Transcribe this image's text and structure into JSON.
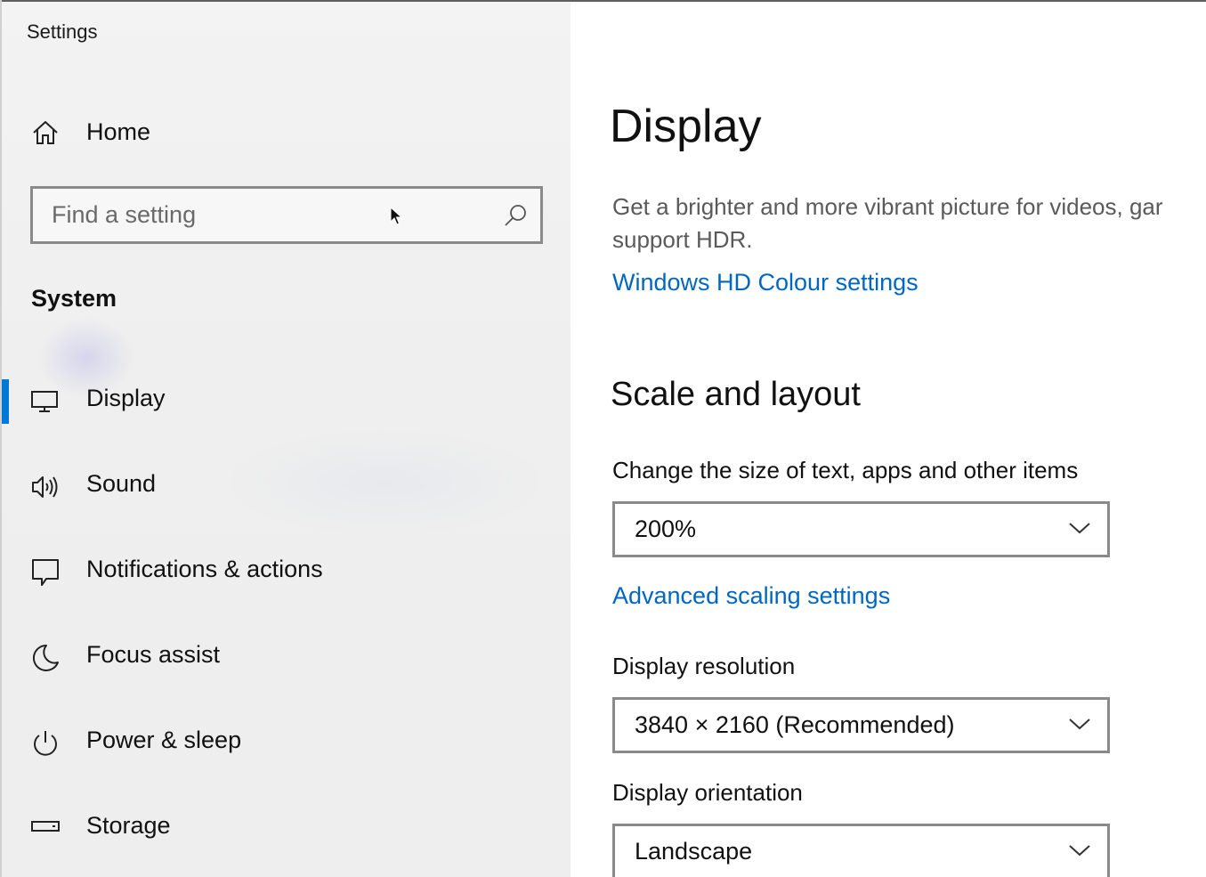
{
  "window": {
    "title": "Settings"
  },
  "sidebar": {
    "home_label": "Home",
    "search": {
      "placeholder": "Find a setting"
    },
    "section_label": "System",
    "items": [
      {
        "label": "Display",
        "icon": "monitor-icon",
        "active": true
      },
      {
        "label": "Sound",
        "icon": "speaker-icon",
        "active": false
      },
      {
        "label": "Notifications & actions",
        "icon": "notification-icon",
        "active": false
      },
      {
        "label": "Focus assist",
        "icon": "moon-icon",
        "active": false
      },
      {
        "label": "Power & sleep",
        "icon": "power-icon",
        "active": false
      },
      {
        "label": "Storage",
        "icon": "storage-icon",
        "active": false
      }
    ]
  },
  "main": {
    "title": "Display",
    "hdr": {
      "description_line1": "Get a brighter and more vibrant picture for videos, gar",
      "description_line2": "support HDR.",
      "link_label": "Windows HD Colour settings"
    },
    "scale_layout": {
      "heading": "Scale and layout",
      "size_label": "Change the size of text, apps and other items",
      "size_value": "200%",
      "advanced_link": "Advanced scaling settings",
      "resolution_label": "Display resolution",
      "resolution_value": "3840 × 2160 (Recommended)",
      "orientation_label": "Display orientation",
      "orientation_value": "Landscape"
    }
  },
  "colors": {
    "accent": "#0078d7",
    "link": "#0067c0",
    "sidebar_bg": "#f0f0f0",
    "content_bg": "#ffffff"
  }
}
